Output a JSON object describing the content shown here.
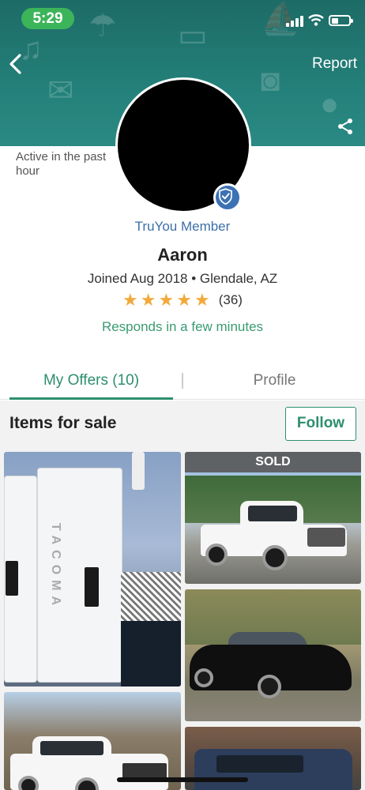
{
  "status_bar": {
    "time": "5:29"
  },
  "header": {
    "report_label": "Report"
  },
  "profile": {
    "activity": "Active in the past hour",
    "badge": "TruYou Member",
    "name": "Aaron",
    "joined": "Joined Aug 2018 • Glendale, AZ",
    "rating_count": "(36)",
    "rating_stars": 5,
    "response_time": "Responds in a few minutes"
  },
  "tabs": [
    {
      "label": "My Offers (10)",
      "active": true
    },
    {
      "label": "Profile",
      "active": false
    }
  ],
  "items_section": {
    "title": "Items for sale",
    "follow_label": "Follow"
  },
  "listings": [
    {
      "image": "white tacoma tailgate",
      "sold": false,
      "tailgate_text": "TACOMA"
    },
    {
      "image": "white ram pickup truck",
      "sold": true,
      "sold_label": "SOLD"
    },
    {
      "image": "black nissan sedan",
      "sold": false
    },
    {
      "image": "white chevy pickup truck",
      "sold": false
    },
    {
      "image": "blue pickup truck",
      "sold": false
    }
  ],
  "colors": {
    "header_teal": "#24807a",
    "accent_green": "#2d8f6c",
    "link_blue": "#3d6fa8",
    "star_orange": "#f2a93b",
    "time_pill_green": "#3cb45a"
  }
}
